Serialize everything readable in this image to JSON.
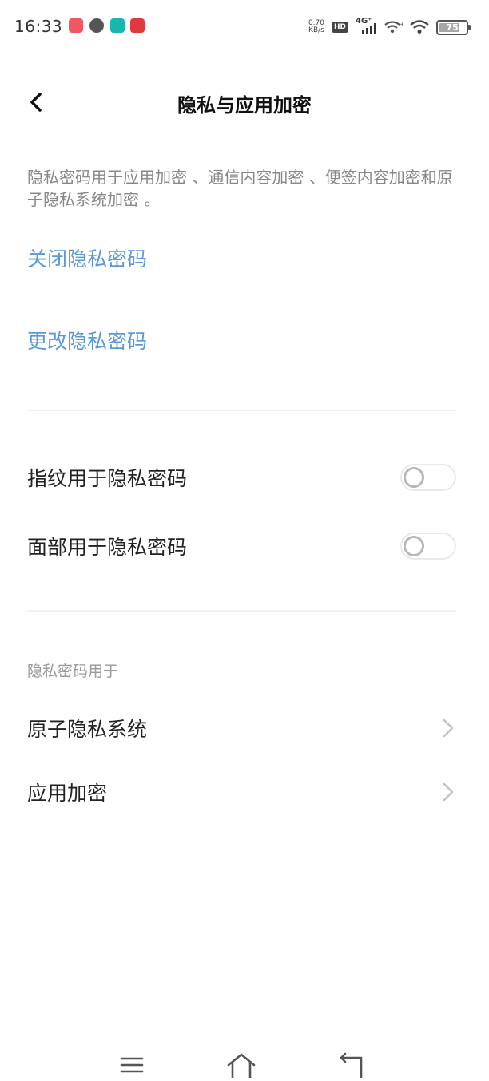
{
  "status_bar": {
    "time": "16:33",
    "net_speed_value": "0.70",
    "net_speed_unit": "KB/s",
    "hd_label": "HD",
    "network_label": "4G⁺",
    "battery_level": "75",
    "app_icon_colors": [
      "#f0575f",
      "#555555",
      "#17b6b0",
      "#e0393e"
    ]
  },
  "header": {
    "title": "隐私与应用加密"
  },
  "description": "隐私密码用于应用加密 、通信内容加密 、便签内容加密和原子隐私系统加密 。",
  "actions": {
    "close_password": "关闭隐私密码",
    "change_password": "更改隐私密码"
  },
  "biometrics": [
    {
      "label": "指纹用于隐私密码",
      "enabled": false
    },
    {
      "label": "面部用于隐私密码",
      "enabled": false
    }
  ],
  "usage_section": {
    "title": "隐私密码用于",
    "items": [
      {
        "label": "原子隐私系统"
      },
      {
        "label": "应用加密"
      }
    ]
  },
  "colors": {
    "accent_link": "#5a98d8",
    "text_primary": "#222222",
    "text_secondary": "#888888"
  },
  "icons": {
    "back": "chevron-left-icon",
    "chevron": "chevron-right-icon",
    "nav": [
      "menu-icon",
      "home-icon",
      "back-arrow-icon"
    ]
  }
}
